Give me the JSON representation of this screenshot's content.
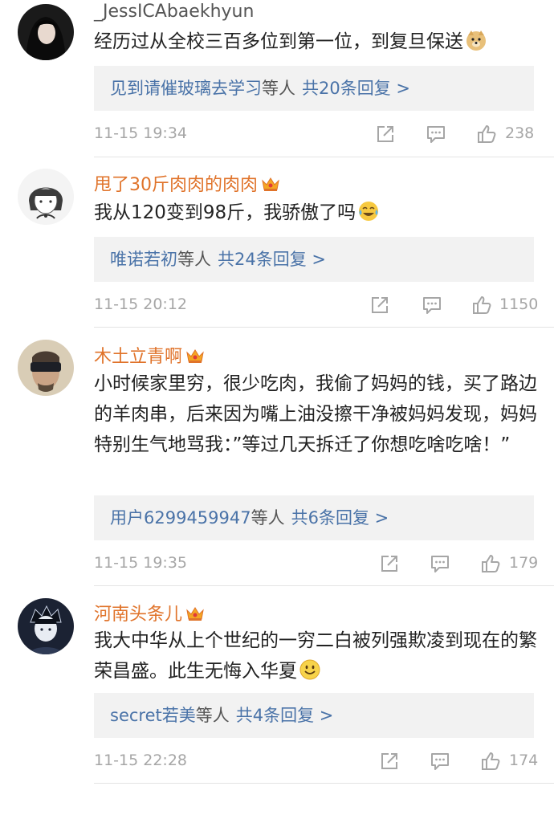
{
  "comments": [
    {
      "username": "_JessICAbaekhyun",
      "text": "经历过从全校三百多位到第一位，到复旦保送",
      "emoji": "doge-emoji",
      "replies_names": "见到请催玻璃去学习",
      "replies_suffix": "等人",
      "replies_count": "共20条回复 >",
      "time": "11-15 19:34",
      "likes": "238"
    },
    {
      "username": "甩了30斤肉肉的肉肉",
      "text": "我从120变到98斤，我骄傲了吗",
      "emoji": "laugh-cry-emoji",
      "replies_names": "唯诺若初",
      "replies_suffix": "等人",
      "replies_count": "共24条回复 >",
      "time": "11-15 20:12",
      "likes": "1150"
    },
    {
      "username": "木土立青啊",
      "text": "小时候家里穷，很少吃肉，我偷了妈妈的钱，买了路边的羊肉串，后来因为嘴上油没擦干净被妈妈发现，妈妈特别生气地骂我：”等过几天拆迁了你想吃啥吃啥！”",
      "replies_names": "用户6299459947",
      "replies_suffix": "等人",
      "replies_count": "共6条回复 >",
      "time": "11-15 19:35",
      "likes": "179"
    },
    {
      "username": "河南头条儿",
      "text": "我大中华从上个世纪的一穷二白被列强欺凌到现在的繁荣昌盛。此生无悔入华夏",
      "emoji": "smile-emoji",
      "replies_names": "secret若美",
      "replies_suffix": "等人",
      "replies_count": "共4条回复 >",
      "time": "11-15 22:28",
      "likes": "174"
    }
  ],
  "colors": {
    "link": "#4a73a8",
    "vip_name": "#e0732a",
    "meta": "#a6a6a6",
    "reply_bg": "#f2f2f2"
  }
}
